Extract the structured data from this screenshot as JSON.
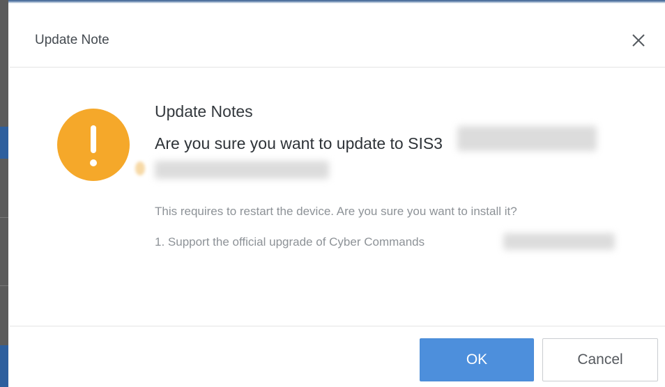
{
  "dialog": {
    "title": "Update Note",
    "close_symbol": "×",
    "icon": "warning-exclamation-icon",
    "heading": "Update Notes",
    "question": "Are you sure you want to update to SIS3",
    "detail": "This requires to restart the device. Are you sure you want to install it?",
    "item": "1. Support the official upgrade of Cyber Commands",
    "ok_label": "OK",
    "cancel_label": "Cancel"
  },
  "colors": {
    "accent": "#4d8fdc",
    "warning": "#f5a82a",
    "title_text": "#444a50",
    "muted_text": "#8d9297"
  }
}
